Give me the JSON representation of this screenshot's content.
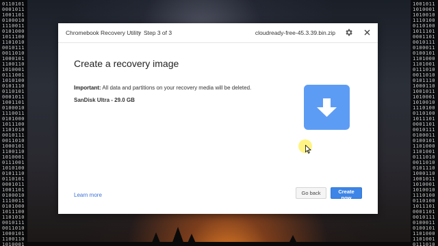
{
  "window": {
    "app_title": "Chromebook Recovery Utility",
    "step_separator": "›",
    "step_label": "Step 3 of 3",
    "file_name": "cloudready-free-45.3.39.bin.zip",
    "settings_icon": "gear-icon",
    "close_icon": "close-icon"
  },
  "content": {
    "heading": "Create a recovery image",
    "warning_prefix": "Important:",
    "warning_text": " All data and partitions on your recovery media will be deleted.",
    "drive_label": "SanDisk Ultra - 29.0 GB",
    "tile_icon": "download-arrow-icon",
    "tile_color": "#5d9cf5"
  },
  "footer": {
    "learn_more": "Learn more",
    "back_label": "Go back",
    "create_label": "Create now",
    "accent_color": "#3d85e6"
  },
  "wallpaper": {
    "binary_left": "0110101000101110011010100010111001101010001011100110101000101110011010100010111001101010001011100110101000101110011010100010111001101010001011100110101000101110011010100010111001101010001011100110101000101110011010100010111001101010001011100110101000101110011010100010111001101010001011100110101000101110011010100010111001101010001011100110101000101110011010100010111001101010001011100110101000101110",
    "binary_right": "1001011101000110100101110100011010010111010001101001011101000110100101110100011010010111010001101001011101000110100101110100011010010111010001101001011101000110100101110100011010010111010001101001011101000110100101110100011010010111010001101001011101000110100101110100011010010111010001101001011101000110100101110100011010010111010001101001011101000110100101110100011010010111010001101001011101000110"
  }
}
